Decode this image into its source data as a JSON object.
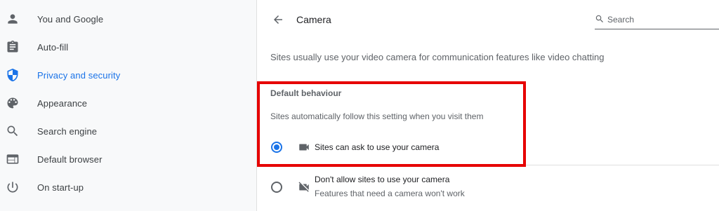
{
  "sidebar": {
    "items": [
      {
        "label": "You and Google",
        "icon": "person-icon",
        "active": false
      },
      {
        "label": "Auto-fill",
        "icon": "clipboard-icon",
        "active": false
      },
      {
        "label": "Privacy and security",
        "icon": "shield-icon",
        "active": true
      },
      {
        "label": "Appearance",
        "icon": "palette-icon",
        "active": false
      },
      {
        "label": "Search engine",
        "icon": "search-icon",
        "active": false
      },
      {
        "label": "Default browser",
        "icon": "browser-icon",
        "active": false
      },
      {
        "label": "On start-up",
        "icon": "power-icon",
        "active": false
      }
    ]
  },
  "header": {
    "title": "Camera",
    "search_placeholder": "Search"
  },
  "main": {
    "description": "Sites usually use your video camera for communication features like video chatting",
    "default_behaviour": {
      "title": "Default behaviour",
      "subtitle": "Sites automatically follow this setting when you visit them",
      "options": [
        {
          "label": "Sites can ask to use your camera",
          "sublabel": "",
          "icon": "videocam-icon",
          "checked": true
        },
        {
          "label": "Don't allow sites to use your camera",
          "sublabel": "Features that need a camera won't work",
          "icon": "videocam-off-icon",
          "checked": false
        }
      ]
    }
  },
  "colors": {
    "accent": "#1a73e8",
    "highlight": "#e60000",
    "sidebar_bg": "#f8f9fa"
  }
}
